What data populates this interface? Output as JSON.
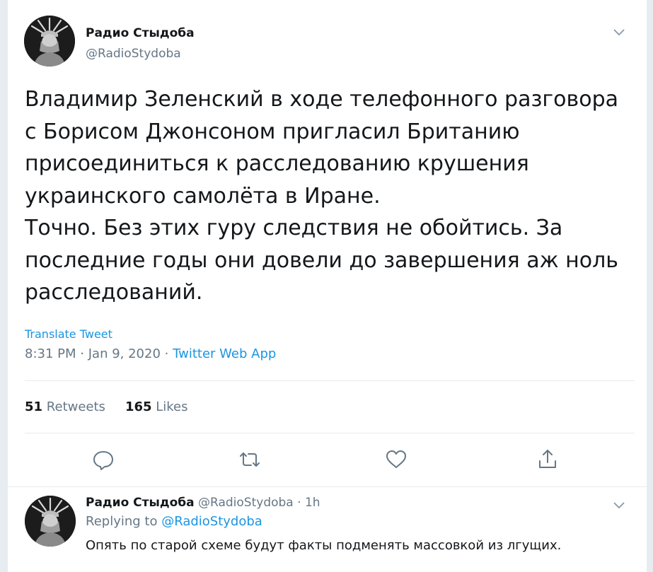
{
  "main_tweet": {
    "display_name": "Радио Стыдоба",
    "handle": "@RadioStydoba",
    "text": "Владимир Зеленский в ходе телефонного разговора\nс Борисом Джонсоном пригласил Британию\nприсоединиться к расследованию крушения\nукраинского самолёта в Иране.\nТочно. Без этих гуру следствия не обойтись. За\nпоследние годы они довели до завершения аж ноль\nрасследований.",
    "translate_label": "Translate Tweet",
    "time": "8:31 PM",
    "date": "Jan 9, 2020",
    "source_app": "Twitter Web App",
    "separator": "·",
    "retweets_count": "51",
    "retweets_label": "Retweets",
    "likes_count": "165",
    "likes_label": "Likes"
  },
  "icons": {
    "reply": "comment-icon",
    "retweet": "retweet-icon",
    "like": "heart-icon",
    "share": "share-icon",
    "menu": "chevron-down-icon"
  },
  "reply_tweet": {
    "display_name": "Радио Стыдоба",
    "handle": "@RadioStydoba",
    "separator": "·",
    "age": "1h",
    "replying_prefix": "Replying to",
    "replying_to": "@RadioStydoba",
    "text": "Опять по старой схеме будут факты подменять массовкой из лгущих."
  },
  "colors": {
    "link_blue": "#1b95e0",
    "secondary_text": "#657786",
    "primary_text": "#14171a",
    "divider": "#e6ecf0"
  }
}
